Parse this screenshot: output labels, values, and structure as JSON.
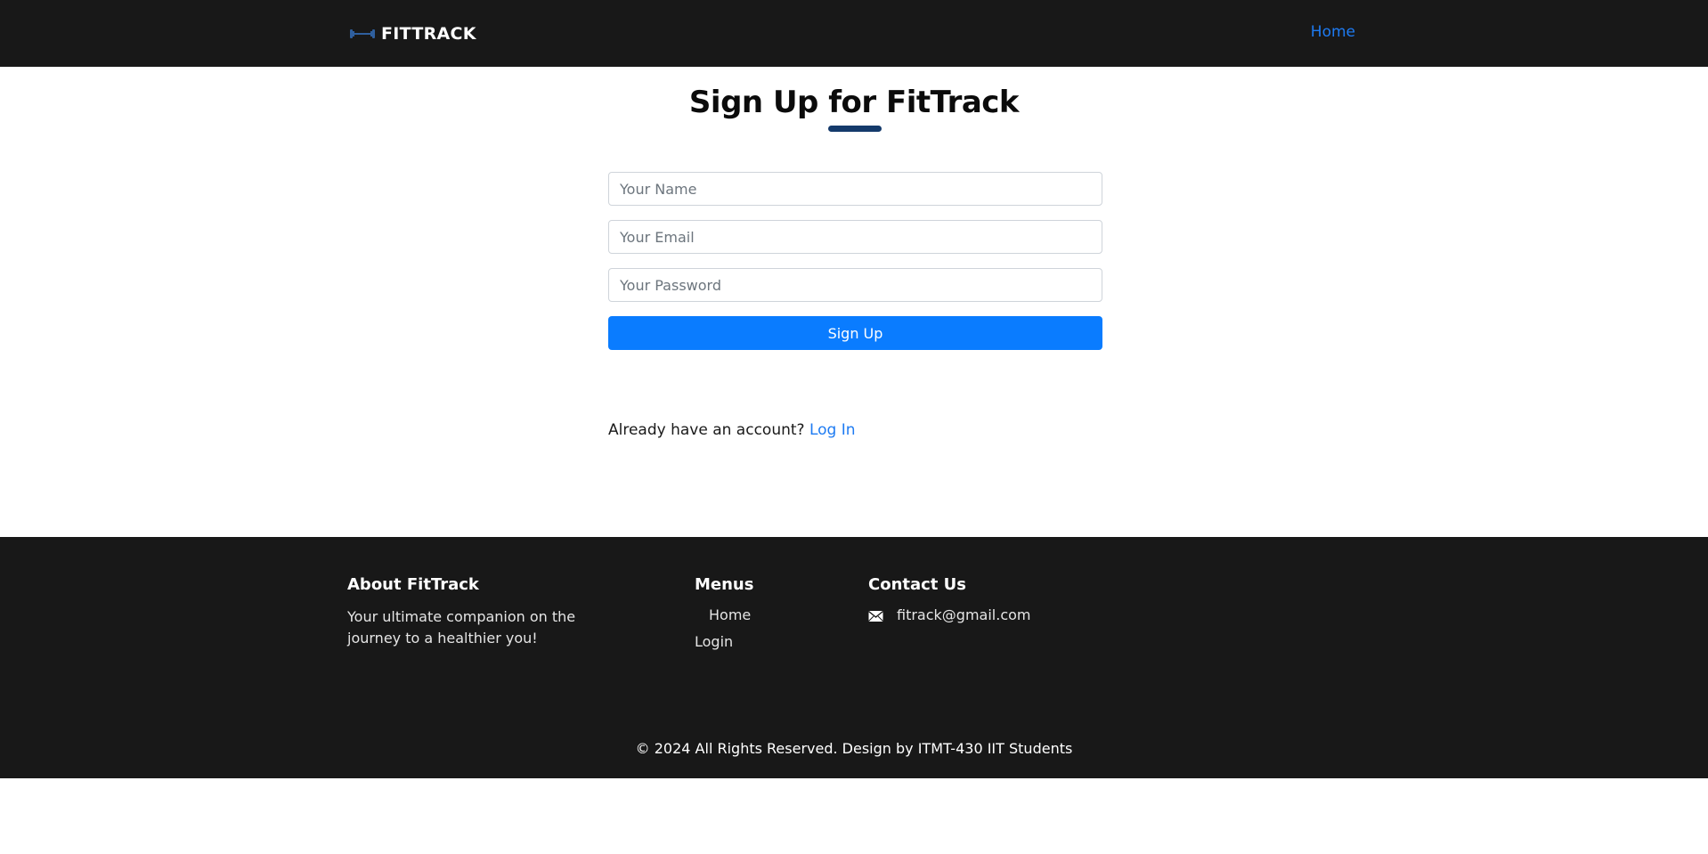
{
  "header": {
    "brand_name": "FITTRACK",
    "brand_icon": "dumbbell-icon",
    "nav_home": "Home"
  },
  "main": {
    "title": "Sign Up for FitTrack",
    "form": {
      "name_placeholder": "Your Name",
      "email_placeholder": "Your Email",
      "password_placeholder": "Your Password",
      "submit_label": "Sign Up"
    },
    "login_prompt": "Already have an account?",
    "login_link": "Log In"
  },
  "footer": {
    "about_heading": "About FitTrack",
    "about_text": "Your ultimate companion on the journey to a healthier you!",
    "menus_heading": "Menus",
    "menu_items": [
      "Home",
      "Login"
    ],
    "contact_heading": "Contact Us",
    "contact_icon": "envelope-icon",
    "contact_email": "fitrack@gmail.com",
    "copyright": "© 2024 All Rights Reserved. Design by ITMT-430 IIT Students"
  },
  "colors": {
    "header_bg": "#181818",
    "accent_blue": "#0a7cff",
    "link_blue": "#1e7bf2",
    "title_underline": "#143a6b",
    "footer_bg": "#181818"
  }
}
